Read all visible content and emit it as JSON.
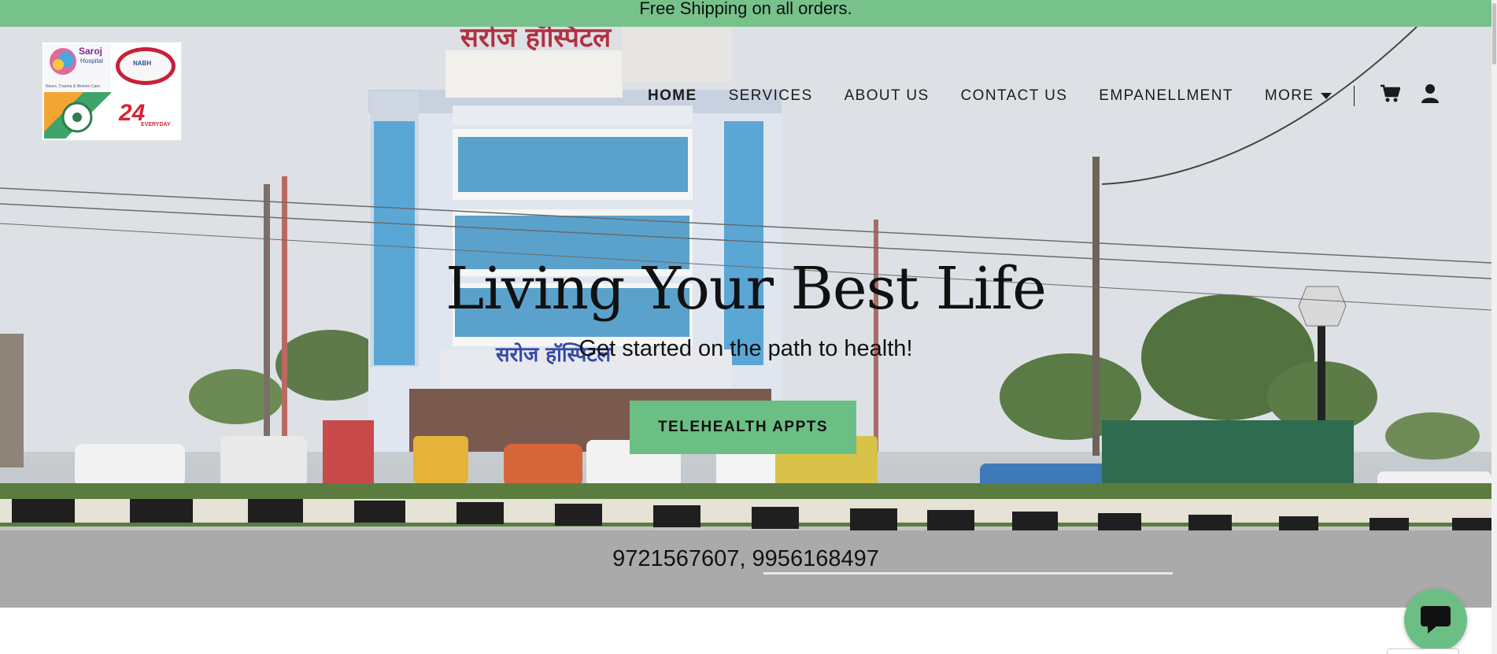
{
  "announcement": {
    "text": "Free Shipping on all orders."
  },
  "brand": {
    "logo_name": "Saroj",
    "logo_hospital": "Hospital",
    "logo_tagline": "Neuro, Trauma & Women Care",
    "badge_text": "NABH",
    "badge_24": "24",
    "badge_everyday": "EVERYDAY"
  },
  "nav": {
    "items": [
      {
        "label": "HOME",
        "active": true
      },
      {
        "label": "SERVICES",
        "active": false
      },
      {
        "label": "ABOUT US",
        "active": false
      },
      {
        "label": "CONTACT US",
        "active": false
      },
      {
        "label": "EMPANELLMENT",
        "active": false
      }
    ],
    "more_label": "MORE",
    "icons": {
      "cart": "cart-icon",
      "account": "user-icon",
      "more": "caret-down-icon"
    }
  },
  "hero": {
    "title": "Living Your Best Life",
    "subtitle": "Get started on the path to health!",
    "cta_label": "TELEHEALTH APPTS",
    "phones": "9721567607, 9956168497",
    "sign_text": "सरोज हॉस्पिटल"
  },
  "chat": {
    "icon": "chat-bubble-icon"
  },
  "colors": {
    "accent": "#6cbf84",
    "announce_bg": "#76c28a",
    "text": "#111111"
  }
}
